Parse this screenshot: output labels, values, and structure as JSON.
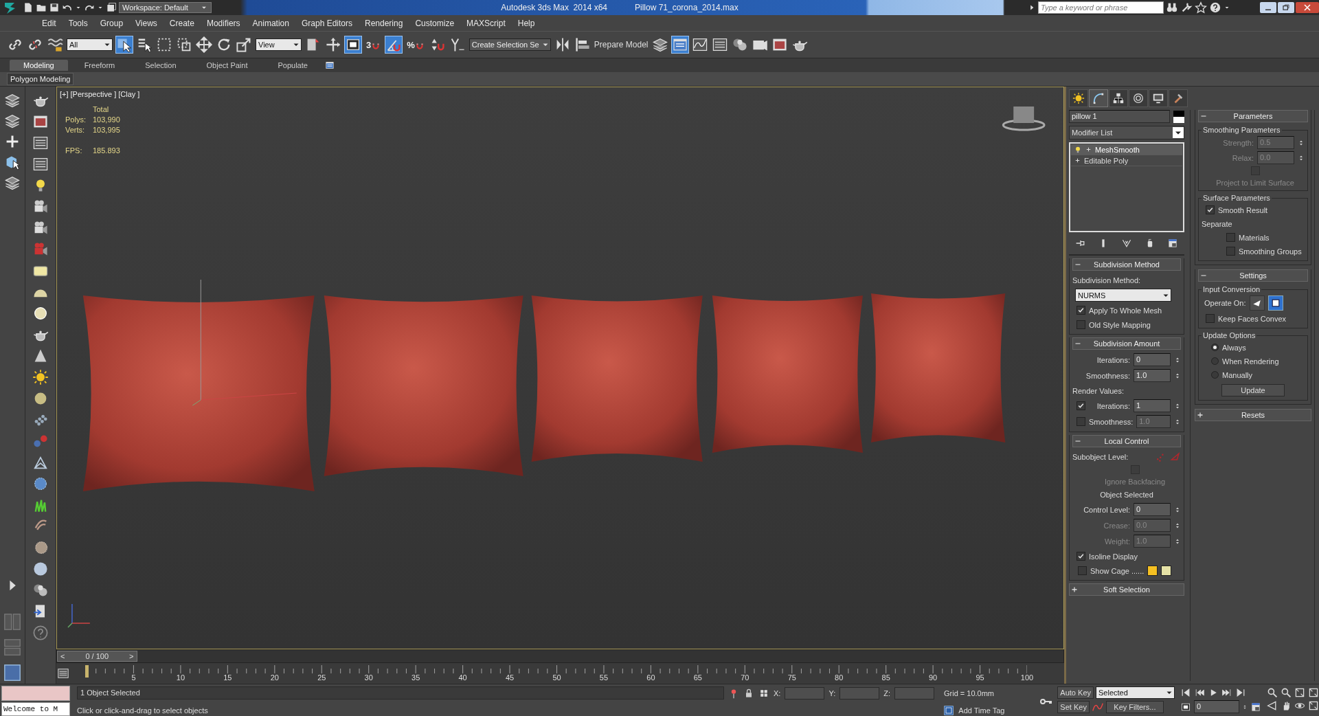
{
  "title_bar": {
    "workspace": "Workspace: Default",
    "app": "Autodesk 3ds Max  2014 x64",
    "file": "Pillow 71_corona_2014.max",
    "search": {
      "placeholder": "Type a keyword or phrase"
    }
  },
  "menu": [
    "Edit",
    "Tools",
    "Group",
    "Views",
    "Create",
    "Modifiers",
    "Animation",
    "Graph Editors",
    "Rendering",
    "Customize",
    "MAXScript",
    "Help"
  ],
  "main_toolbar": [
    {
      "kind": "link",
      "selected": false
    },
    {
      "kind": "unlink",
      "selected": false
    },
    {
      "kind": "bind",
      "selected": false
    },
    {
      "kind": "filter",
      "value": "All"
    },
    {
      "kind": "select",
      "selected": true
    },
    {
      "kind": "select_by_name",
      "selected": false
    },
    {
      "kind": "region",
      "selected": false
    },
    {
      "kind": "crossing",
      "selected": false
    },
    {
      "kind": "move",
      "selected": false
    },
    {
      "kind": "rotate",
      "selected": false
    },
    {
      "kind": "scale",
      "selected": false
    },
    {
      "kind": "refcoord",
      "value": "View"
    },
    {
      "kind": "pivot",
      "selected": false
    },
    {
      "kind": "manipulate",
      "selected": false
    },
    {
      "kind": "keyboard",
      "selected": true
    },
    {
      "kind": "snap",
      "label": "3",
      "selected": false
    },
    {
      "kind": "angle_snap",
      "selected": true
    },
    {
      "kind": "percent_snap",
      "label": "%",
      "selected": false
    },
    {
      "kind": "spinner_snap",
      "selected": false
    },
    {
      "kind": "named_edit",
      "selected": false
    },
    {
      "kind": "named_selection",
      "value": "Create Selection Se"
    },
    {
      "kind": "mirror",
      "selected": false
    },
    {
      "kind": "align",
      "selected": false
    },
    {
      "kind": "prepare",
      "label": "Prepare Model"
    },
    {
      "kind": "layers",
      "selected": false
    },
    {
      "kind": "ribbon",
      "selected": true
    },
    {
      "kind": "curve",
      "selected": false
    },
    {
      "kind": "schematic",
      "selected": false
    },
    {
      "kind": "material",
      "selected": false
    },
    {
      "kind": "render_setup",
      "selected": false
    },
    {
      "kind": "frame_window",
      "selected": false
    },
    {
      "kind": "teapot",
      "selected": false
    }
  ],
  "ribbon": {
    "tabs": [
      {
        "label": "Modeling",
        "selected": true
      },
      {
        "label": "Freeform",
        "selected": false
      },
      {
        "label": "Selection",
        "selected": false
      },
      {
        "label": "Object Paint",
        "selected": false
      },
      {
        "label": "Populate",
        "selected": false
      }
    ],
    "panel": "Polygon Modeling"
  },
  "viewport": {
    "labels": [
      "[+]",
      "[Perspective ]",
      "[Clay ]"
    ],
    "stats": {
      "heading": "Total",
      "rows": [
        {
          "label": "Polys:",
          "value": "103,990"
        },
        {
          "label": "Verts:",
          "value": "103,995"
        }
      ],
      "fps_label": "FPS:",
      "fps": "185.893"
    }
  },
  "time_slider": {
    "prev": "<",
    "position": "0 / 100",
    "next": ">"
  },
  "track_bar": {
    "ticks": [
      "5",
      "10",
      "15",
      "20",
      "25",
      "30",
      "35",
      "40",
      "45",
      "50",
      "55",
      "60",
      "65",
      "70",
      "75",
      "80",
      "85",
      "90",
      "95",
      "100"
    ]
  },
  "command_panel": {
    "tabs": [
      {
        "kind": "create",
        "selected": false
      },
      {
        "kind": "modify",
        "selected": true
      },
      {
        "kind": "hierarchy",
        "selected": false
      },
      {
        "kind": "motion",
        "selected": false
      },
      {
        "kind": "display",
        "selected": false
      },
      {
        "kind": "utilities",
        "selected": false
      }
    ],
    "object_name": "pillow 1",
    "modifier_list": "Modifier List",
    "stack": [
      {
        "label": "MeshSmooth",
        "selected": true,
        "bulb": true
      },
      {
        "label": "Editable Poly",
        "selected": false,
        "bulb": false
      }
    ],
    "left_rollouts": [
      {
        "title": "Subdivision Method",
        "expanded": true,
        "controls": [
          {
            "kind": "label",
            "text": "Subdivision Method:"
          },
          {
            "kind": "dropdown",
            "value": "NURMS"
          },
          {
            "kind": "check",
            "label": "Apply To Whole Mesh",
            "checked": true,
            "disabled": false
          },
          {
            "kind": "check",
            "label": "Old Style Mapping",
            "checked": false,
            "disabled": false
          }
        ]
      },
      {
        "title": "Subdivision Amount",
        "expanded": true,
        "controls": [
          {
            "kind": "spinner",
            "label": "Iterations:",
            "value": "0",
            "disabled": false
          },
          {
            "kind": "spinner",
            "label": "Smoothness:",
            "value": "1.0",
            "disabled": false
          },
          {
            "kind": "label",
            "text": "Render Values:"
          },
          {
            "kind": "check_spinner",
            "label": "Iterations:",
            "value": "1",
            "checked": true,
            "disabled": false
          },
          {
            "kind": "check_spinner",
            "label": "Smoothness:",
            "value": "1.0",
            "checked": false,
            "disabled": false
          }
        ]
      },
      {
        "title": "Local Control",
        "expanded": true,
        "controls": [
          {
            "kind": "subobject",
            "label": "Subobject Level:"
          },
          {
            "kind": "check",
            "label": "Ignore Backfacing",
            "checked": false,
            "disabled": true
          },
          {
            "kind": "note",
            "text": "Object Selected"
          },
          {
            "kind": "spinner",
            "label": "Control Level:",
            "value": "0",
            "disabled": false
          },
          {
            "kind": "spinner",
            "label": "Crease:",
            "value": "0.0",
            "disabled": true
          },
          {
            "kind": "spinner",
            "label": "Weight:",
            "value": "1.0",
            "disabled": true
          },
          {
            "kind": "check",
            "label": "Isoline Display",
            "checked": true,
            "disabled": false
          },
          {
            "kind": "cage",
            "label": "Show Cage ......",
            "checked": false,
            "disabled": false,
            "swatches": [
              {
                "color": "#f5c022"
              },
              {
                "color": "#e6e2a6"
              }
            ]
          }
        ]
      },
      {
        "title": "Soft Selection",
        "expanded": false
      }
    ],
    "right_rollouts": [
      {
        "title": "Parameters",
        "expanded": true,
        "controls": [
          {
            "kind": "group",
            "title": "Smoothing Parameters",
            "controls": [
              {
                "kind": "spinner",
                "label": "Strength:",
                "value": "0.5",
                "disabled": true
              },
              {
                "kind": "spinner",
                "label": "Relax:",
                "value": "0.0",
                "disabled": true
              },
              {
                "kind": "check",
                "label": "Project to Limit Surface",
                "checked": false,
                "disabled": true
              }
            ]
          },
          {
            "kind": "group",
            "title": "Surface Parameters",
            "controls": [
              {
                "kind": "check",
                "label": "Smooth Result",
                "checked": true,
                "disabled": false
              },
              {
                "kind": "label",
                "text": "Separate"
              },
              {
                "kind": "subcheck",
                "label": "Materials",
                "checked": false,
                "disabled": false
              },
              {
                "kind": "subcheck",
                "label": "Smoothing Groups",
                "checked": false,
                "disabled": false
              }
            ]
          }
        ]
      },
      {
        "title": "Settings",
        "expanded": true,
        "controls": [
          {
            "kind": "group",
            "title": "Input Conversion",
            "controls": [
              {
                "kind": "operate",
                "label": "Operate On:",
                "options": [
                  {
                    "kind": "triangle",
                    "selected": false
                  },
                  {
                    "kind": "polygon",
                    "selected": true
                  }
                ]
              },
              {
                "kind": "check",
                "label": "Keep Faces Convex",
                "checked": false,
                "disabled": false
              }
            ]
          },
          {
            "kind": "group",
            "title": "Update Options",
            "controls": [
              {
                "kind": "radio",
                "label": "Always",
                "selected": true
              },
              {
                "kind": "radio",
                "label": "When Rendering",
                "selected": false
              },
              {
                "kind": "radio",
                "label": "Manually",
                "selected": false
              },
              {
                "kind": "button",
                "label": "Update"
              }
            ]
          }
        ]
      },
      {
        "title": "Resets",
        "expanded": false
      }
    ]
  },
  "status_bar": {
    "listener": "Welcome to M",
    "selection": "1 Object Selected",
    "prompt": "Click or click-and-drag to select objects",
    "x_label": "X:",
    "y_label": "Y:",
    "z_label": "Z:",
    "grid": "Grid = 10.0mm",
    "time_tag": "Add Time Tag",
    "auto_key": "Auto Key",
    "set_key": "Set Key",
    "key_mode": "Selected",
    "key_filters": "Key Filters...",
    "frame": "0"
  }
}
